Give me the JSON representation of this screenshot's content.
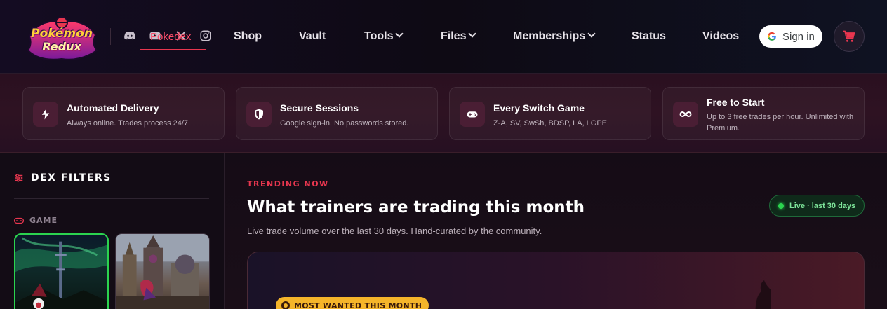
{
  "brand": {
    "line1": "Pokémon",
    "line2": "Redux"
  },
  "header": {
    "social": [
      "discord-icon",
      "youtube-icon",
      "x-icon",
      "instagram-icon"
    ],
    "pokedex_label": "Pokedex",
    "nav": [
      {
        "label": "Shop"
      },
      {
        "label": "Vault"
      },
      {
        "label": "Tools"
      },
      {
        "label": "Files"
      },
      {
        "label": "Memberships"
      },
      {
        "label": "Status"
      },
      {
        "label": "Videos"
      }
    ],
    "signin_label": "Sign in",
    "cart_icon": "cart-icon"
  },
  "features": [
    {
      "title": "Automated Delivery",
      "desc": "Always online. Trades process 24/7.",
      "icon": "bolt-icon"
    },
    {
      "title": "Secure Sessions",
      "desc": "Google sign-in. No passwords stored.",
      "icon": "shield-icon"
    },
    {
      "title": "Every Switch Game",
      "desc": "Z-A, SV, SwSh, BDSP, LA, LGPE.",
      "icon": "gamepad-icon"
    },
    {
      "title": "Free to Start",
      "desc": "Up to 3 free trades per hour. Unlimited with Premium.",
      "icon": "infinity-icon"
    }
  ],
  "sidebar": {
    "title": "DEX FILTERS",
    "game_section": "GAME"
  },
  "main": {
    "eyebrow": "TRENDING NOW",
    "title": "What trainers are trading this month",
    "subtitle": "Live trade volume over the last 30 days. Hand-curated by the community.",
    "live_badge": "Live · last 30 days",
    "hero_badge": "MOST WANTED THIS MONTH"
  },
  "colors": {
    "accent": "#e8364f",
    "live": "#2bd44f",
    "badge": "#f5b52a"
  }
}
